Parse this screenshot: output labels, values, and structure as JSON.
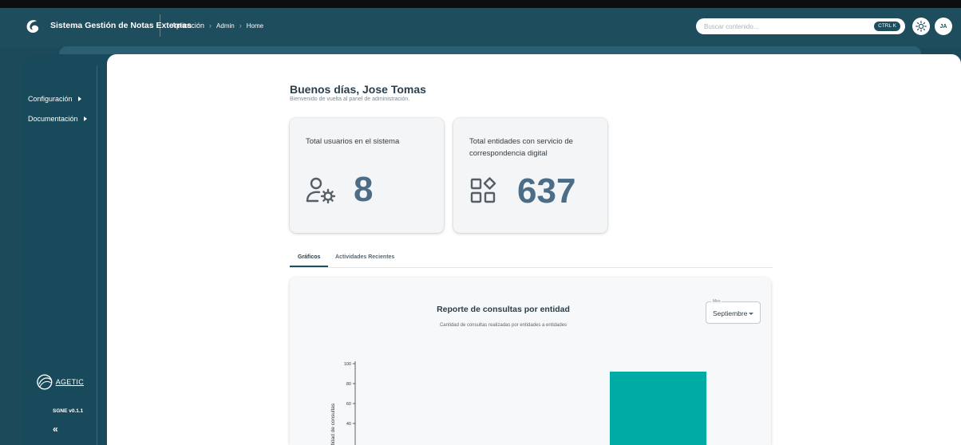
{
  "header": {
    "app_title": "Sistema Gestión de Notas Externas",
    "breadcrumbs": [
      "Aplicación",
      "Admin",
      "Home"
    ],
    "search_placeholder": "Buscar contenido...",
    "search_shortcut": "CTRL K",
    "theme_icon": "sun-icon",
    "avatar_initials": "JA",
    "colors": {
      "bar": "#1e4d5e",
      "sidebar": "#184a5b"
    }
  },
  "sidebar": {
    "items": [
      {
        "label": "Configuración",
        "icon": "caret-right-icon"
      },
      {
        "label": "Documentación",
        "icon": "caret-right-icon"
      }
    ],
    "org_logo_text": "AGETIC",
    "version": "SGNE v0.1.1",
    "collapse_label": "«"
  },
  "main": {
    "greeting": "Buenos días, Jose Tomas",
    "greeting_sub": "Bienvenido de vuelta al panel de administración.",
    "cards": [
      {
        "title": "Total usuarios en el sistema",
        "value": "8",
        "icon": "user-settings-icon"
      },
      {
        "title": "Total entidades con servicio de correspondencia digital",
        "value": "637",
        "icon": "categories-icon"
      }
    ],
    "tabs": [
      {
        "label": "Gráficos",
        "active": true
      },
      {
        "label": "Actividades Recientes",
        "active": false
      }
    ],
    "month_select": {
      "legend": "Mes",
      "value": "Septiembre"
    }
  },
  "chart_data": {
    "type": "bar",
    "title": "Reporte de consultas por entidad",
    "subtitle": "Cantidad de consultas realizadas por entidades a entidades",
    "ylabel": "Cantidad de consultas",
    "ylim": [
      0,
      100
    ],
    "yticks": [
      "100",
      "80",
      "60",
      "40"
    ],
    "values": [
      92
    ],
    "bar_color": "#00aaa5"
  }
}
